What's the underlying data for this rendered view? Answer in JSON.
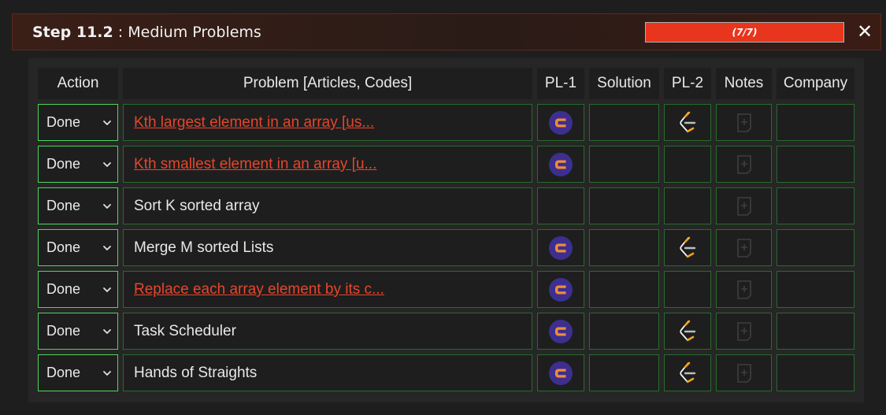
{
  "header": {
    "step_label": "Step 11.2",
    "separator": " : ",
    "title": "Medium Problems",
    "progress_text": "(7/7)",
    "progress_fraction": 1.0,
    "close_glyph": "✕"
  },
  "columns": [
    "Action",
    "Problem [Articles, Codes]",
    "PL-1",
    "Solution",
    "PL-2",
    "Notes",
    "Company"
  ],
  "rows": [
    {
      "status": "Done",
      "problem": "Kth largest element in an array [us...",
      "is_link": true,
      "pl1_icon": "codingninjas-icon",
      "pl2_icon": "leetcode-icon",
      "notes_icon": "add-note-icon"
    },
    {
      "status": "Done",
      "problem": "Kth smallest element in an array [u...",
      "is_link": true,
      "pl1_icon": "codingninjas-icon",
      "pl2_icon": null,
      "notes_icon": "add-note-icon"
    },
    {
      "status": "Done",
      "problem": "Sort K sorted array",
      "is_link": false,
      "pl1_icon": null,
      "pl2_icon": null,
      "notes_icon": "add-note-icon"
    },
    {
      "status": "Done",
      "problem": "Merge M sorted Lists",
      "is_link": false,
      "pl1_icon": "codingninjas-icon",
      "pl2_icon": "leetcode-icon",
      "notes_icon": "add-note-icon"
    },
    {
      "status": "Done",
      "problem": "Replace each array element by its c...",
      "is_link": true,
      "pl1_icon": "codingninjas-icon",
      "pl2_icon": null,
      "notes_icon": "add-note-icon"
    },
    {
      "status": "Done",
      "problem": "Task Scheduler",
      "is_link": false,
      "pl1_icon": "codingninjas-icon",
      "pl2_icon": "leetcode-icon",
      "notes_icon": "add-note-icon"
    },
    {
      "status": "Done",
      "problem": "Hands of Straights",
      "is_link": false,
      "pl1_icon": "codingninjas-icon",
      "pl2_icon": "leetcode-icon",
      "notes_icon": "add-note-icon"
    }
  ],
  "colors": {
    "accent": "#e8351d",
    "link": "#e8452a",
    "cell_border": "#276b2c",
    "select_border": "#4ed65a",
    "codingninjas_bg": "#3d2f8f",
    "codingninjas_fg": "#f08c3a",
    "leetcode_orange": "#f7a21b"
  }
}
